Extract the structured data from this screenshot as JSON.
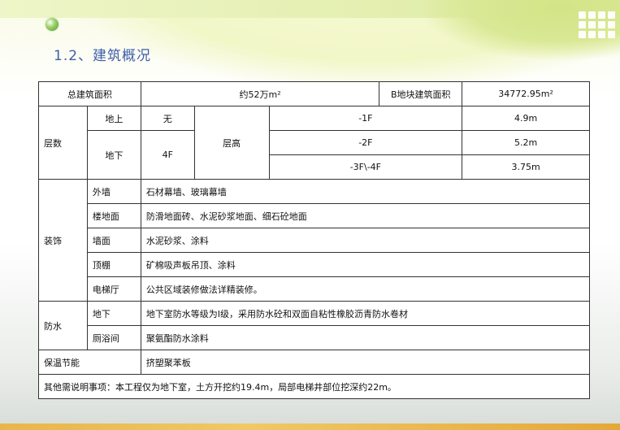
{
  "title": "1.2、建筑概况",
  "area": {
    "total_label": "总建筑面积",
    "total_value": "约52万m²",
    "b_label": "B地块建筑面积",
    "b_value": "34772.95m²"
  },
  "floors": {
    "label": "层数",
    "above_label": "地上",
    "above_value": "无",
    "below_label": "地下",
    "below_value": "4F",
    "height_label": "层高",
    "rows": [
      {
        "floor": "-1F",
        "height": "4.9m"
      },
      {
        "floor": "-2F",
        "height": "5.2m"
      },
      {
        "floor": "-3F\\-4F",
        "height": "3.75m"
      }
    ]
  },
  "decoration": {
    "label": "装饰",
    "rows": [
      {
        "part": "外墙",
        "desc": "石材幕墙、玻璃幕墙"
      },
      {
        "part": "楼地面",
        "desc": "防滑地面砖、水泥砂浆地面、细石砼地面"
      },
      {
        "part": "墙面",
        "desc": "水泥砂浆、涂料"
      },
      {
        "part": "顶棚",
        "desc": "矿棉吸声板吊顶、涂料"
      },
      {
        "part": "电梯厅",
        "desc": "公共区域装修做法详精装修。"
      }
    ]
  },
  "waterproof": {
    "label": "防水",
    "rows": [
      {
        "part": "地下",
        "desc": "地下室防水等级为I级，采用防水砼和双面自粘性橡胶沥青防水卷材"
      },
      {
        "part": "厕浴间",
        "desc": "聚氨酯防水涂料"
      }
    ]
  },
  "insulation": {
    "label": "保温节能",
    "value": "挤塑聚苯板"
  },
  "notes": "其他需说明事项：本工程仅为地下室，土方开挖约19.4m，局部电梯井部位挖深约22m。"
}
